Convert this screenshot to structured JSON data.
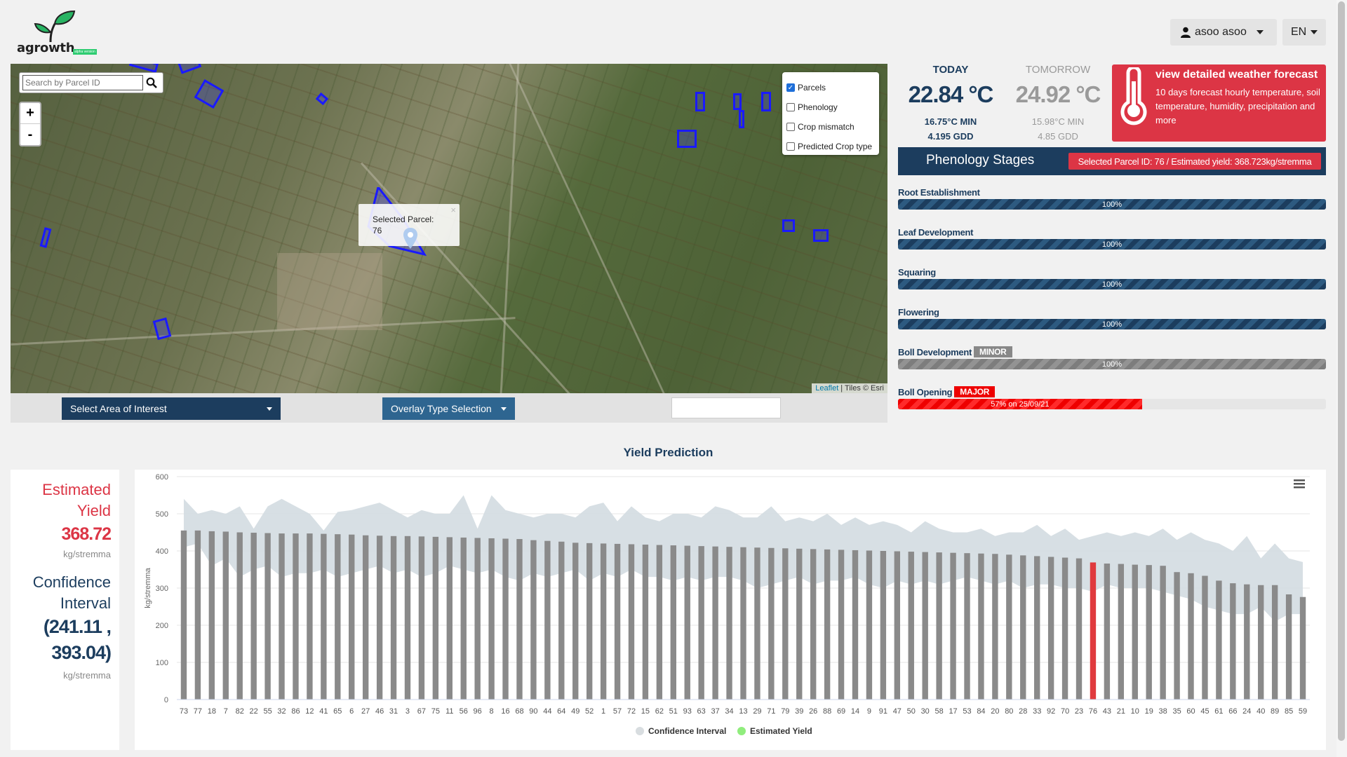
{
  "header": {
    "logo_text": "agrowth",
    "logo_badge": "alpha version",
    "user_label": "asoo asoo",
    "lang_label": "EN"
  },
  "map": {
    "search_placeholder": "Search by Parcel ID",
    "zoom_in": "+",
    "zoom_out": "-",
    "layers": [
      {
        "label": "Parcels",
        "checked": true
      },
      {
        "label": "Phenology",
        "checked": false
      },
      {
        "label": "Crop mismatch",
        "checked": false
      },
      {
        "label": "Predicted Crop type",
        "checked": false
      }
    ],
    "popup_title": "Selected Parcel:",
    "popup_value": "76",
    "popup_close": "×",
    "attribution_link": "Leaflet",
    "attribution_text": " | Tiles © Esri"
  },
  "controls": {
    "area_select": "Select Area of Interest",
    "overlay_select": "Overlay Type Selection"
  },
  "weather": {
    "today_label": "TODAY",
    "today_temp": "22.84 °C",
    "today_min": "16.75°C MIN",
    "today_gdd": "4.195 GDD",
    "tomorrow_label": "TOMORROW",
    "tomorrow_temp": "24.92 °C",
    "tomorrow_min": "15.98°C MIN",
    "tomorrow_gdd": "4.85 GDD",
    "forecast_title": "view detailed weather forecast",
    "forecast_desc": "10 days forecast hourly temperature, soil temperature, humidity, precipitation and more",
    "accent_color": "#dc3545"
  },
  "phenology": {
    "title": "Phenology Stages",
    "badge": "Selected Parcel ID: 76 / Estimated yield: 368.723kg/stremma",
    "stages": [
      {
        "label": "Root Establishment",
        "value_text": "100%",
        "progress": 100,
        "tag": ""
      },
      {
        "label": "Leaf Development",
        "value_text": "100%",
        "progress": 100,
        "tag": ""
      },
      {
        "label": "Squaring",
        "value_text": "100%",
        "progress": 100,
        "tag": ""
      },
      {
        "label": "Flowering",
        "value_text": "100%",
        "progress": 100,
        "tag": ""
      },
      {
        "label": "Boll Development",
        "value_text": "100%",
        "progress": 100,
        "tag": "MINOR"
      },
      {
        "label": "Boll Opening",
        "value_text": "57% on 25/09/21",
        "progress": 57,
        "tag": "MAJOR"
      }
    ]
  },
  "yield": {
    "section_title": "Yield Prediction",
    "est_label_1": "Estimated",
    "est_label_2": "Yield",
    "est_value": "368.72",
    "est_unit": "kg/stremma",
    "ci_label_1": "Confidence",
    "ci_label_2": "Interval",
    "ci_value_1": "(241.11 ,",
    "ci_value_2": "393.04)",
    "ci_unit": "kg/stremma"
  },
  "chart_data": {
    "type": "bar",
    "ylabel": "kg/stremma",
    "ylim": [
      0,
      600
    ],
    "yticks": [
      0,
      100,
      200,
      300,
      400,
      500,
      600
    ],
    "highlight_category": "76",
    "highlight_color": "#e03a3e",
    "bar_color": "#8a8a8a",
    "band_color": "#d3dce1",
    "legend": [
      "Confidence Interval",
      "Estimated Yield"
    ],
    "legend_colors": [
      "#d8dde0",
      "#90ed7d"
    ],
    "categories": [
      "73",
      "77",
      "18",
      "7",
      "82",
      "22",
      "55",
      "32",
      "86",
      "12",
      "41",
      "65",
      "6",
      "27",
      "46",
      "31",
      "3",
      "67",
      "75",
      "11",
      "56",
      "96",
      "8",
      "16",
      "68",
      "90",
      "44",
      "64",
      "49",
      "52",
      "1",
      "57",
      "72",
      "15",
      "62",
      "51",
      "93",
      "63",
      "37",
      "34",
      "13",
      "29",
      "71",
      "79",
      "39",
      "26",
      "88",
      "69",
      "14",
      "9",
      "91",
      "47",
      "50",
      "30",
      "58",
      "17",
      "53",
      "84",
      "20",
      "80",
      "28",
      "33",
      "92",
      "70",
      "23",
      "76",
      "43",
      "21",
      "10",
      "19",
      "38",
      "35",
      "60",
      "45",
      "61",
      "66",
      "24",
      "40",
      "89",
      "85",
      "59"
    ],
    "values": [
      455,
      455,
      453,
      452,
      450,
      449,
      448,
      447,
      447,
      447,
      446,
      445,
      444,
      442,
      441,
      440,
      440,
      439,
      438,
      437,
      436,
      435,
      434,
      433,
      432,
      429,
      427,
      425,
      422,
      421,
      420,
      419,
      418,
      417,
      416,
      415,
      414,
      413,
      412,
      411,
      410,
      409,
      408,
      407,
      406,
      405,
      404,
      403,
      402,
      401,
      400,
      399,
      398,
      397,
      396,
      395,
      394,
      393,
      392,
      390,
      388,
      386,
      384,
      382,
      380,
      369,
      366,
      365,
      363,
      362,
      360,
      343,
      340,
      333,
      320,
      313,
      310,
      308,
      308,
      283,
      276
    ],
    "upper": [
      540,
      500,
      510,
      500,
      520,
      460,
      520,
      540,
      520,
      500,
      455,
      505,
      510,
      520,
      530,
      510,
      490,
      510,
      500,
      500,
      550,
      460,
      550,
      510,
      500,
      490,
      500,
      500,
      490,
      520,
      530,
      480,
      520,
      490,
      480,
      500,
      500,
      490,
      520,
      510,
      490,
      490,
      520,
      480,
      490,
      480,
      500,
      470,
      490,
      470,
      480,
      470,
      450,
      480,
      460,
      450,
      450,
      460,
      440,
      450,
      450,
      470,
      440,
      460,
      430,
      440,
      450,
      440,
      450,
      440,
      460,
      430,
      450,
      430,
      420,
      400,
      440,
      380,
      420,
      380,
      370
    ],
    "lower": [
      410,
      420,
      360,
      380,
      330,
      350,
      360,
      330,
      340,
      340,
      350,
      330,
      340,
      350,
      360,
      340,
      350,
      330,
      340,
      360,
      350,
      340,
      350,
      330,
      320,
      340,
      330,
      340,
      350,
      320,
      340,
      330,
      350,
      330,
      330,
      320,
      330,
      320,
      330,
      330,
      320,
      300,
      310,
      320,
      330,
      310,
      320,
      320,
      330,
      310,
      300,
      320,
      310,
      320,
      310,
      320,
      330,
      320,
      310,
      320,
      300,
      310,
      310,
      300,
      300,
      290,
      310,
      300,
      300,
      300,
      290,
      280,
      270,
      250,
      240,
      230,
      230,
      250,
      210,
      230,
      230
    ]
  }
}
